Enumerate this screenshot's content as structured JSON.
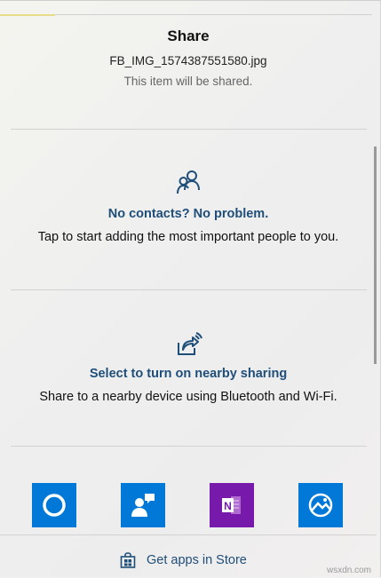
{
  "share": {
    "title": "Share",
    "filename": "FB_IMG_1574387551580.jpg",
    "subtitle": "This item will be shared."
  },
  "contacts": {
    "icon": "people-icon",
    "heading": "No contacts? No problem.",
    "description": "Tap to start adding the most important people to you."
  },
  "nearby": {
    "icon": "nearby-share-icon",
    "heading": "Select to turn on nearby sharing",
    "description": "Share to a nearby device using Bluetooth and Wi-Fi."
  },
  "apps": [
    {
      "name": "Cortana",
      "icon": "cortana-icon",
      "color": "#0078d7"
    },
    {
      "name": "People",
      "icon": "people-app-icon",
      "color": "#0078d7"
    },
    {
      "name": "OneNote",
      "icon": "onenote-icon",
      "color": "#7719aa"
    },
    {
      "name": "Photos",
      "icon": "photos-icon",
      "color": "#0078d7"
    }
  ],
  "store": {
    "label": "Get apps in Store",
    "icon": "store-bag-icon"
  },
  "watermark": "wsxdn.com",
  "colors": {
    "accent": "#1f4e79",
    "tile_blue": "#0078d7",
    "tile_purple": "#7719aa",
    "top_accent": "#e7dc87"
  }
}
